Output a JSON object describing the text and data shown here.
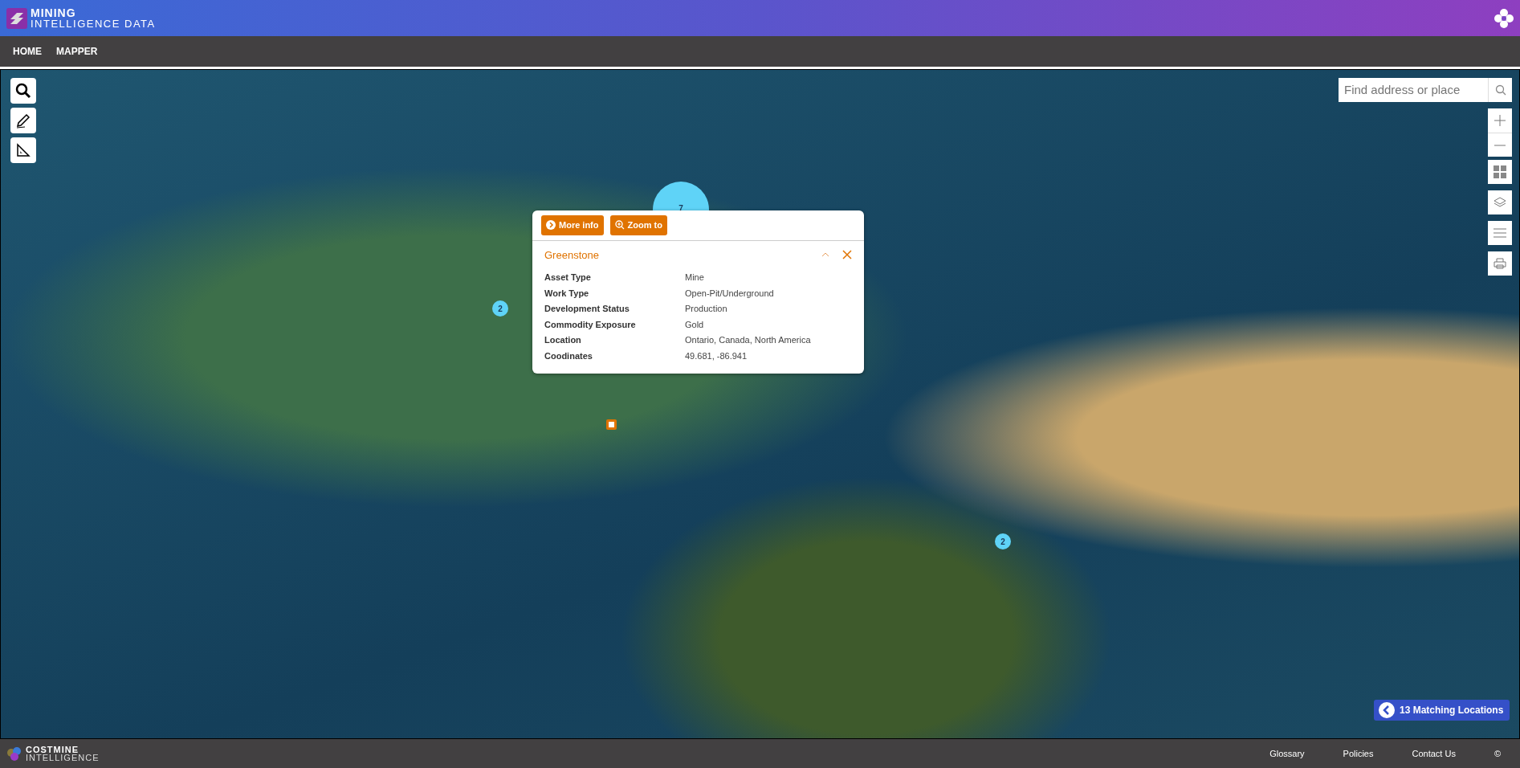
{
  "header": {
    "brand_line_1": "MINING",
    "brand_line_2": "INTELLIGENCE DATA"
  },
  "nav": [
    {
      "label": "HOME",
      "selected": false
    },
    {
      "label": "MAPPER",
      "selected": false
    }
  ],
  "map": {
    "search": {
      "placeholder": "Find address or place"
    },
    "clusters": [
      {
        "count": "7",
        "kind": "large"
      },
      {
        "count": "2",
        "kind": "small"
      },
      {
        "count": "2",
        "kind": "small"
      },
      {
        "kind": "single"
      }
    ],
    "popup": {
      "actions": [
        "More info",
        "Zoom to"
      ],
      "title": "Greenstone",
      "fields": [
        {
          "label": "Asset Type",
          "value": "Mine"
        },
        {
          "label": "Work Type",
          "value": "Open-Pit/Underground"
        },
        {
          "label": "Development Status",
          "value": "Production"
        },
        {
          "label": "Commodity Exposure",
          "value": "Gold"
        },
        {
          "label": "Location",
          "value": "Ontario, Canada, North America"
        },
        {
          "label": "Coodinates",
          "value": "49.681, -86.941"
        }
      ]
    },
    "results_button": "13 Matching Locations"
  },
  "footer": {
    "brand_line_1": "COSTMINE",
    "brand_line_2": "INTELLIGENCE",
    "links": [
      "Glossary",
      "Policies",
      "Contact Us",
      "©"
    ]
  }
}
